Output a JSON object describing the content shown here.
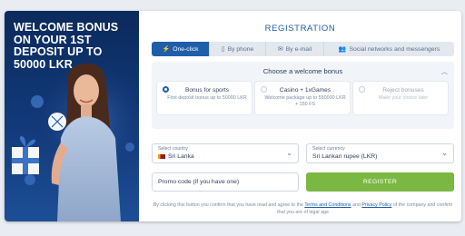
{
  "promo": {
    "title": "WELCOME BONUS ON YOUR 1ST DEPOSIT UP TO 50000 LKR"
  },
  "registration": {
    "title": "REGISTRATION",
    "tabs": [
      {
        "label": "One-click",
        "icon": "lightning-icon",
        "active": true
      },
      {
        "label": "By phone",
        "icon": "phone-icon",
        "active": false
      },
      {
        "label": "By e-mail",
        "icon": "email-icon",
        "active": false
      },
      {
        "label": "Social networks and messengers",
        "icon": "people-icon",
        "active": false
      }
    ],
    "bonus": {
      "heading": "Choose a welcome bonus",
      "options": [
        {
          "title": "Bonus for sports",
          "subtitle": "First deposit bonus up to 50000 LKR",
          "selected": true
        },
        {
          "title": "Casino + 1xGames",
          "subtitle": "Welcome package up to 550000 LKR + 150 FS",
          "selected": false
        },
        {
          "title": "Reject bonuses",
          "subtitle": "Make your choice later",
          "selected": false
        }
      ]
    },
    "country": {
      "label": "Select country",
      "value": "Sri Lanka"
    },
    "currency": {
      "label": "Select currency",
      "value": "Sri Lankan rupee (LKR)"
    },
    "promo_code": {
      "placeholder": "Promo code (if you have one)"
    },
    "register_label": "REGISTER",
    "legal": {
      "part1": "By clicking this button you confirm that you have read and agree to the",
      "terms_link": "Terms and Conditions",
      "and": "and",
      "privacy_link": "Privacy Policy",
      "part2": "of the company and confirm that you are of legal age"
    }
  },
  "colors": {
    "brand_blue": "#1f5ea8",
    "register_green": "#7bb843",
    "promo_bg": "#0b2a5c"
  }
}
